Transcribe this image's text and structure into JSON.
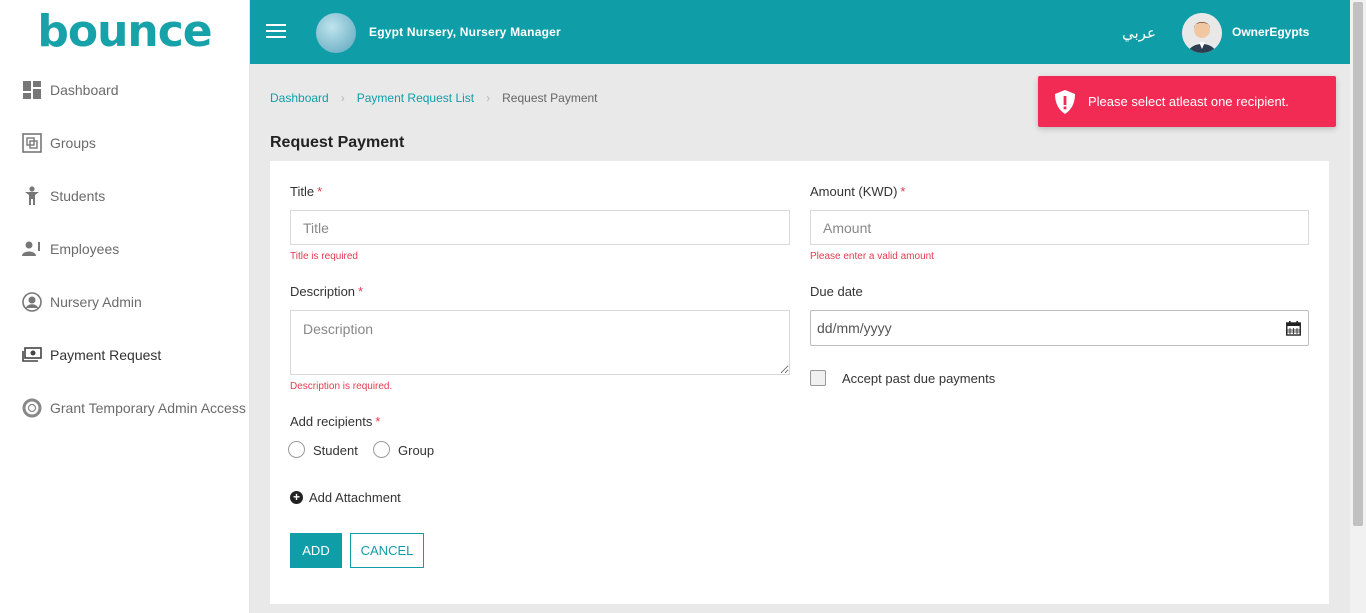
{
  "app": {
    "logo_text": "bounce"
  },
  "sidebar": {
    "items": [
      {
        "label": "Dashboard",
        "icon": "dashboard-icon"
      },
      {
        "label": "Groups",
        "icon": "groups-icon"
      },
      {
        "label": "Students",
        "icon": "student-icon"
      },
      {
        "label": "Employees",
        "icon": "employees-icon"
      },
      {
        "label": "Nursery Admin",
        "icon": "user-circle-icon"
      },
      {
        "label": "Payment Request",
        "icon": "money-icon"
      },
      {
        "label": "Grant Temporary Admin Access",
        "icon": "lifebuoy-icon"
      }
    ]
  },
  "topbar": {
    "org_name": "Egypt Nursery, Nursery Manager",
    "language": "عربي",
    "user_name": "OwnerEgypts"
  },
  "breadcrumb": {
    "items": [
      "Dashboard",
      "Payment Request List",
      "Request Payment"
    ]
  },
  "page": {
    "title": "Request Payment"
  },
  "form": {
    "title_label": "Title",
    "title_placeholder": "Title",
    "title_error": "Title is required",
    "amount_label": "Amount (KWD)",
    "amount_placeholder": "Amount",
    "amount_error": "Please enter a valid amount",
    "description_label": "Description",
    "description_placeholder": "Description",
    "description_error": "Description is required.",
    "due_date_label": "Due date",
    "due_date_placeholder": "dd/mm/yyyy",
    "accept_past_due_label": "Accept past due payments",
    "recipients_label": "Add recipients",
    "recipient_options": [
      "Student",
      "Group"
    ],
    "add_attachment_label": "Add Attachment",
    "add_button": "ADD",
    "cancel_button": "CANCEL",
    "required_marker": "*"
  },
  "toast": {
    "message": "Please select atleast one recipient."
  },
  "colors": {
    "accent": "#0f9ea8",
    "error": "#e53950",
    "toast": "#f22b55"
  }
}
